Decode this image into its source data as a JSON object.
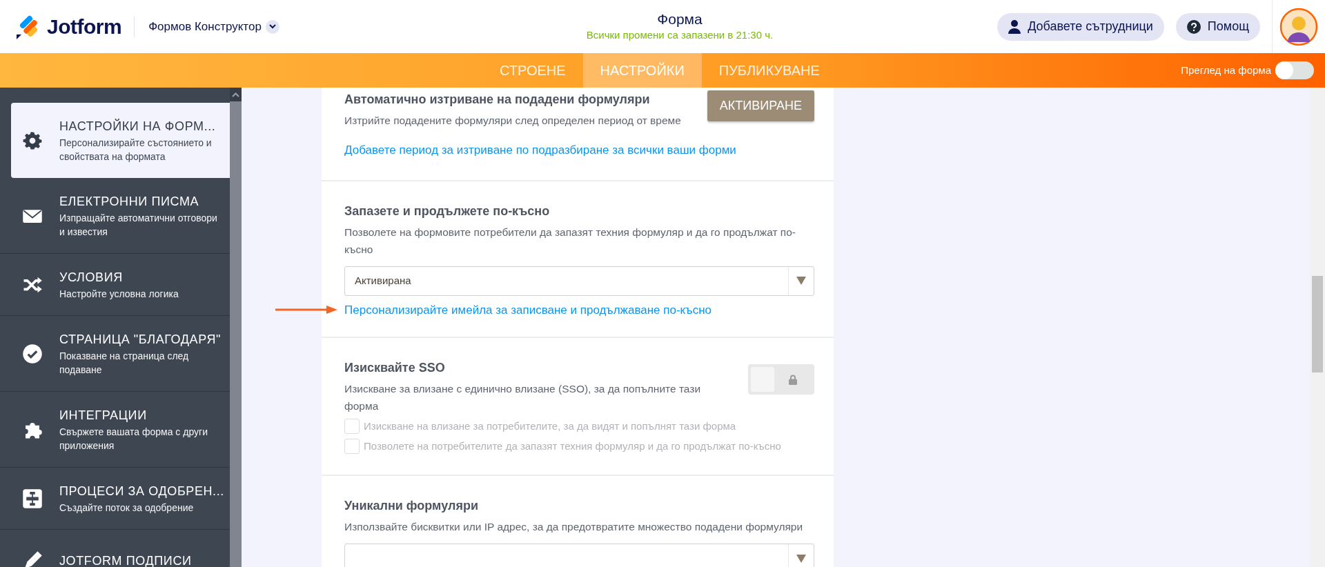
{
  "header": {
    "logo_text": "Jotform",
    "builder_menu": "Формов Конструктор",
    "title": "Форма",
    "save_status": "Всички промени са запазени в 21:30 ч.",
    "buttons": [
      {
        "kind": "collaborators",
        "label": "Добавете сътрудници"
      },
      {
        "kind": "help",
        "label": "Помощ"
      }
    ]
  },
  "tabs": [
    {
      "label": "СТРОЕНЕ",
      "selected": false
    },
    {
      "label": "НАСТРОЙКИ",
      "selected": true
    },
    {
      "label": "ПУБЛИКУВАНЕ",
      "selected": false
    }
  ],
  "preview_toggle": {
    "label": "Преглед на форма",
    "on": false
  },
  "sidebar": {
    "items": [
      {
        "kind": "gear",
        "title": "НАСТРОЙКИ НА ФОРМ...",
        "subtitle": "Персонализирайте състоянието и свойствата на формата",
        "selected": true
      },
      {
        "kind": "envelope",
        "title": "ЕЛЕКТРОННИ ПИСМА",
        "subtitle": "Изпращайте автоматични отговори и известия",
        "selected": false
      },
      {
        "kind": "shuffle",
        "title": "УСЛОВИЯ",
        "subtitle": "Настройте условна логика",
        "selected": false
      },
      {
        "kind": "check",
        "title": "СТРАНИЦА \"БЛАГОДАРЯ\"",
        "subtitle": "Показване на страница след подаване",
        "selected": false
      },
      {
        "kind": "puzzle",
        "title": "ИНТЕГРАЦИИ",
        "subtitle": "Свържете вашата форма с други приложения",
        "selected": false
      },
      {
        "kind": "flow",
        "title": "ПРОЦЕСИ ЗА ОДОБРЕН...",
        "subtitle": "Създайте поток за одобрение",
        "selected": false
      },
      {
        "kind": "pen",
        "title": "JOTFORM ПОДПИСИ",
        "selected": false
      }
    ]
  },
  "sections": [
    {
      "kind": "button",
      "title": "Автоматично изтриване на подадени формуляри",
      "description": "Изтрийте подадените формуляри след определен период от време",
      "button": "АКТИВИРАНЕ",
      "link": "Добавете период за изтриване по подразбиране за всички ваши форми"
    },
    {
      "kind": "select",
      "title": "Запазете и продължете по-късно",
      "description": "Позволете на формовите потребители да запазят техния формуляр и да го продължат по-късно",
      "value": "Активирана",
      "link": "Персонализирайте имейла за записване и продължаване по-късно",
      "pointer_arrow": true
    },
    {
      "kind": "toggle",
      "title": "Изисквайте SSO",
      "description": "Изискване за влизане с единично влизане (SSO), за да попълните тази форма",
      "toggle": {
        "on": false,
        "locked": true
      },
      "checkboxes": [
        {
          "label": "Изискване на влизане за потребителите, за да видят и попълнят тази форма",
          "checked": false,
          "disabled": true
        },
        {
          "label": "Позволете на потребителите да запазят техния формуляр и да го продължат по-късно",
          "checked": false,
          "disabled": true
        }
      ]
    },
    {
      "kind": "select",
      "title": "Уникални формуляри",
      "description": "Използвайте бисквитки или IP адрес, за да предотвратите множество подадени формуляри"
    }
  ]
}
